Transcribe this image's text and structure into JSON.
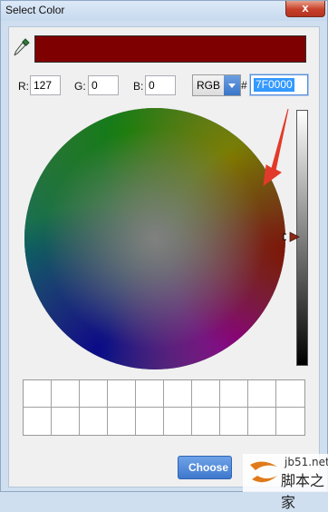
{
  "window": {
    "title": "Select Color",
    "close_glyph": "x"
  },
  "preview": {
    "color": "#7f0000"
  },
  "eyedropper": {
    "icon": "eyedropper-icon"
  },
  "rgb": {
    "r_label": "R:",
    "r_value": "127",
    "g_label": "G:",
    "g_value": "0",
    "b_label": "B:",
    "b_value": "0"
  },
  "mode": {
    "selected": "RGB",
    "hash": "#",
    "hex_value": "7F0000"
  },
  "palette": {
    "rows": 2,
    "cols": 10
  },
  "actions": {
    "choose_label": "Choose"
  },
  "annotation": {
    "color": "#e23a2a"
  },
  "watermark": {
    "url": "jb51.net",
    "text": "脚本之家"
  }
}
